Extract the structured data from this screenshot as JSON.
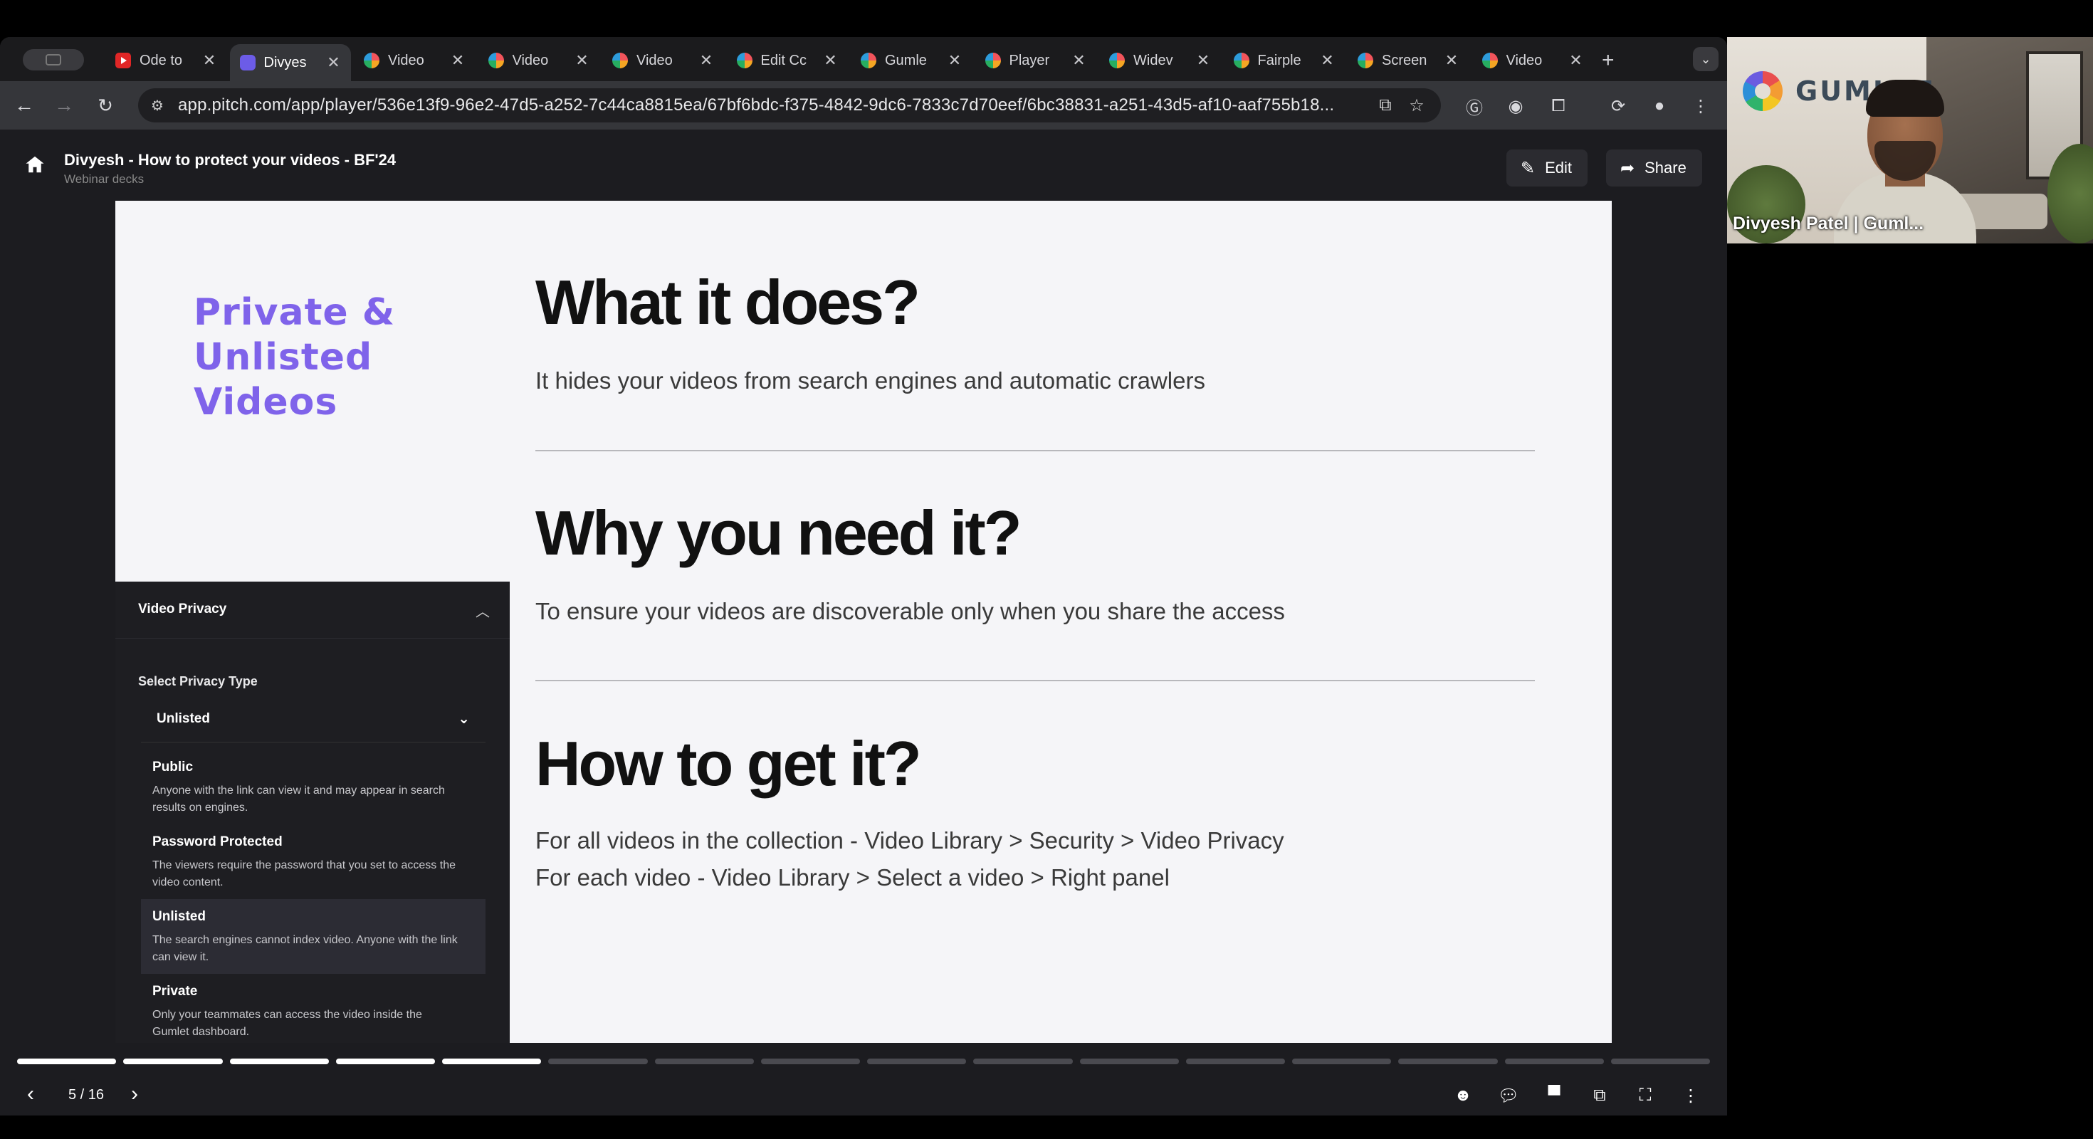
{
  "browser": {
    "tabs": [
      {
        "title": "Ode to",
        "favicon": "youtube"
      },
      {
        "title": "Divyes",
        "favicon": "pitch",
        "active": true
      },
      {
        "title": "Video",
        "favicon": "gumlet"
      },
      {
        "title": "Video",
        "favicon": "gumlet"
      },
      {
        "title": "Video",
        "favicon": "gumlet"
      },
      {
        "title": "Edit Cc",
        "favicon": "gumlet"
      },
      {
        "title": "Gumle",
        "favicon": "gumlet"
      },
      {
        "title": "Player",
        "favicon": "gumlet"
      },
      {
        "title": "Widev",
        "favicon": "gumlet"
      },
      {
        "title": "Fairple",
        "favicon": "gumlet"
      },
      {
        "title": "Screen",
        "favicon": "gumlet"
      },
      {
        "title": "Video",
        "favicon": "gumlet"
      }
    ],
    "new_tab_label": "+",
    "close_glyph": "✕",
    "url": "app.pitch.com/app/player/536e13f9-96e2-47d5-a252-7c44ca8815ea/67bf6bdc-f375-4842-9dc6-7833c7d70eef/6bc38831-a251-43d5-af10-aaf755b18..."
  },
  "app": {
    "deck_title": "Divyesh - How to protect your videos - BF'24",
    "deck_subtitle": "Webinar decks",
    "edit_label": "Edit",
    "share_label": "Share"
  },
  "slide": {
    "side_title": "Private &\nUnlisted\nVideos",
    "accent_color": "#7f63ea",
    "section1": {
      "heading": "What it does?",
      "body": "It hides your videos from search engines and automatic crawlers"
    },
    "section2": {
      "heading": "Why you need it?",
      "body": "To ensure your videos are discoverable only when you share the access"
    },
    "section3": {
      "heading": "How to get it?",
      "body_line1": "For all videos in the collection - Video Library > Security > Video Privacy",
      "body_line2": "For each video - Video Library > Select a video > Right panel"
    },
    "privacy_panel": {
      "title": "Video Privacy",
      "select_label": "Select Privacy Type",
      "selected_value": "Unlisted",
      "options": [
        {
          "name": "Public",
          "desc": "Anyone with the link can view it and may appear in search results on engines."
        },
        {
          "name": "Password Protected",
          "desc": "The viewers require the password that you set to access the video content."
        },
        {
          "name": "Unlisted",
          "desc": "The search engines cannot index video. Anyone with the link can view it.",
          "selected": true
        },
        {
          "name": "Private",
          "desc": "Only your teammates can access the video inside the Gumlet dashboard."
        }
      ]
    }
  },
  "player": {
    "current_slide": 5,
    "total_slides": 16,
    "page_indicator": "5 / 16"
  },
  "call": {
    "participant_name": "Divyesh Patel | Guml...",
    "background_logo_text": "GUMLET"
  }
}
